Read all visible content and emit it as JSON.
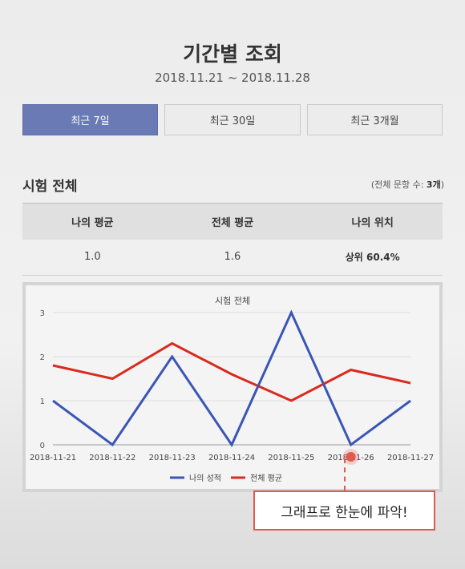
{
  "header": {
    "title": "기간별 조회",
    "date_range": "2018.11.21 ~ 2018.11.28"
  },
  "tabs": [
    {
      "label": "최근 7일",
      "active": true
    },
    {
      "label": "최근 30일",
      "active": false
    },
    {
      "label": "최근 3개월",
      "active": false
    }
  ],
  "section": {
    "title": "시험 전체",
    "count_prefix": "(전체 문항 수: ",
    "count_value": "3개",
    "count_suffix": ")"
  },
  "table": {
    "headers": [
      "나의 평균",
      "전체 평균",
      "나의 위치"
    ],
    "row": [
      "1.0",
      "1.6",
      "상위 60.4%"
    ]
  },
  "chart_data": {
    "type": "line",
    "title": "시험 전체",
    "x": [
      "2018-11-21",
      "2018-11-22",
      "2018-11-23",
      "2018-11-24",
      "2018-11-25",
      "2018-11-26",
      "2018-11-27"
    ],
    "ylim": [
      0,
      3
    ],
    "yticks": [
      "0",
      "1",
      "2",
      "3"
    ],
    "grid": true,
    "legend_position": "bottom",
    "series": [
      {
        "name": "나의 성적",
        "color": "#3a56b5",
        "values": [
          1,
          0,
          2,
          0,
          3,
          0,
          1
        ]
      },
      {
        "name": "전체 평균",
        "color": "#d92b1f",
        "values": [
          1.8,
          1.5,
          2.3,
          1.6,
          1.0,
          1.7,
          1.4
        ]
      }
    ]
  },
  "callout": {
    "text": "그래프로 한눈에 파악!",
    "color": "#e05a4e"
  }
}
